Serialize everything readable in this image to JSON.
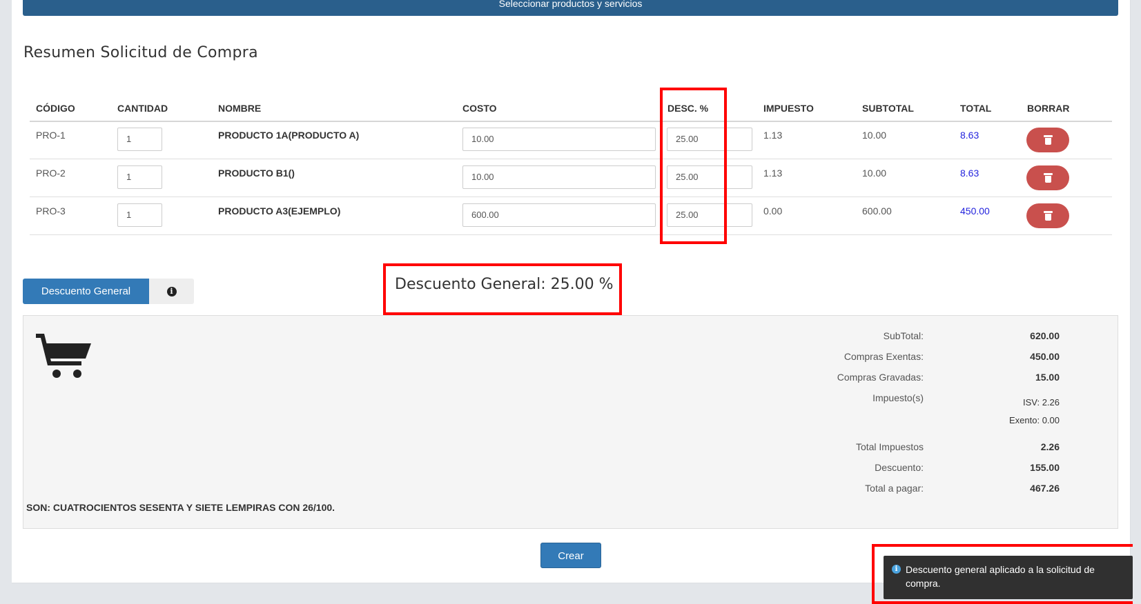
{
  "top_button_label": "Seleccionar productos y servicios",
  "title": "Resumen Solicitud de Compra",
  "table": {
    "headers": [
      "CÓDIGO",
      "CANTIDAD",
      "NOMBRE",
      "COSTO",
      "DESC. %",
      "IMPUESTO",
      "SUBTOTAL",
      "TOTAL",
      "BORRAR"
    ],
    "rows": [
      {
        "codigo": "PRO-1",
        "cantidad": "1",
        "nombre": "PRODUCTO 1A(PRODUCTO A)",
        "costo": "10.00",
        "desc": "25.00",
        "impuesto": "1.13",
        "subtotal": "10.00",
        "total": "8.63"
      },
      {
        "codigo": "PRO-2",
        "cantidad": "1",
        "nombre": "PRODUCTO B1()",
        "costo": "10.00",
        "desc": "25.00",
        "impuesto": "1.13",
        "subtotal": "10.00",
        "total": "8.63"
      },
      {
        "codigo": "PRO-3",
        "cantidad": "1",
        "nombre": "PRODUCTO A3(EJEMPLO)",
        "costo": "600.00",
        "desc": "25.00",
        "impuesto": "0.00",
        "subtotal": "600.00",
        "total": "450.00"
      }
    ],
    "delete_icon": "trash-icon"
  },
  "discount": {
    "button_label": "Descuento General",
    "info_icon": "info-icon",
    "info_glyph": "i",
    "display": "Descuento General: 25.00 %"
  },
  "summary": {
    "cart_icon": "shopping-cart-icon",
    "subtotal_label": "SubTotal:",
    "subtotal": "620.00",
    "exentas_label": "Compras Exentas:",
    "exentas": "450.00",
    "gravadas_label": "Compras Gravadas:",
    "gravadas": "15.00",
    "impuestos_label": "Impuesto(s)",
    "isv": "ISV: 2.26",
    "exento": "Exento: 0.00",
    "total_impuestos_label": "Total Impuestos",
    "total_impuestos": "2.26",
    "descuento_label": "Descuento:",
    "descuento": "155.00",
    "total_pagar_label": "Total a pagar:",
    "total_pagar": "467.26",
    "son": "SON: CUATROCIENTOS SESENTA Y SIETE LEMPIRAS CON 26/100."
  },
  "crear_label": "Crear",
  "toast": {
    "icon": "info-icon",
    "glyph": "i",
    "message": "Descuento general aplicado a la solicitud de compra."
  },
  "colors": {
    "primary": "#337ab7",
    "top_button": "#2a5f8c",
    "danger": "#c9504d",
    "highlight": "#ff0000",
    "link": "#2222dd"
  }
}
